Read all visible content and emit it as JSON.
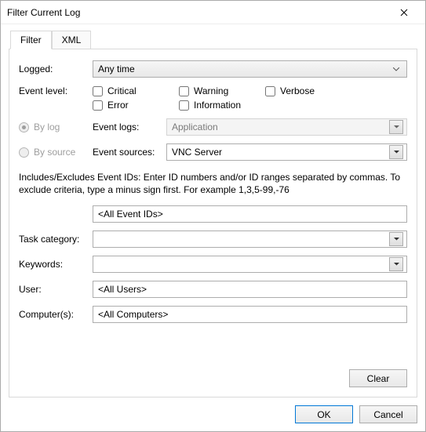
{
  "window": {
    "title": "Filter Current Log"
  },
  "tabs": {
    "filter": "Filter",
    "xml": "XML",
    "active": "filter"
  },
  "labels": {
    "logged": "Logged:",
    "event_level": "Event level:",
    "by_log": "By log",
    "by_source": "By source",
    "event_logs": "Event logs:",
    "event_sources": "Event sources:",
    "task_category": "Task category:",
    "keywords": "Keywords:",
    "user": "User:",
    "computers": "Computer(s):"
  },
  "values": {
    "logged": "Any time",
    "event_logs": "Application",
    "event_sources": "VNC Server",
    "event_ids": "<All Event IDs>",
    "task_category": "",
    "keywords": "",
    "user": "<All Users>",
    "computers": "<All Computers>"
  },
  "checks": {
    "critical": "Critical",
    "warning": "Warning",
    "verbose": "Verbose",
    "error": "Error",
    "information": "Information"
  },
  "hint": "Includes/Excludes Event IDs: Enter ID numbers and/or ID ranges separated by commas. To exclude criteria, type a minus sign first. For example 1,3,5-99,-76",
  "buttons": {
    "clear": "Clear",
    "ok": "OK",
    "cancel": "Cancel"
  }
}
